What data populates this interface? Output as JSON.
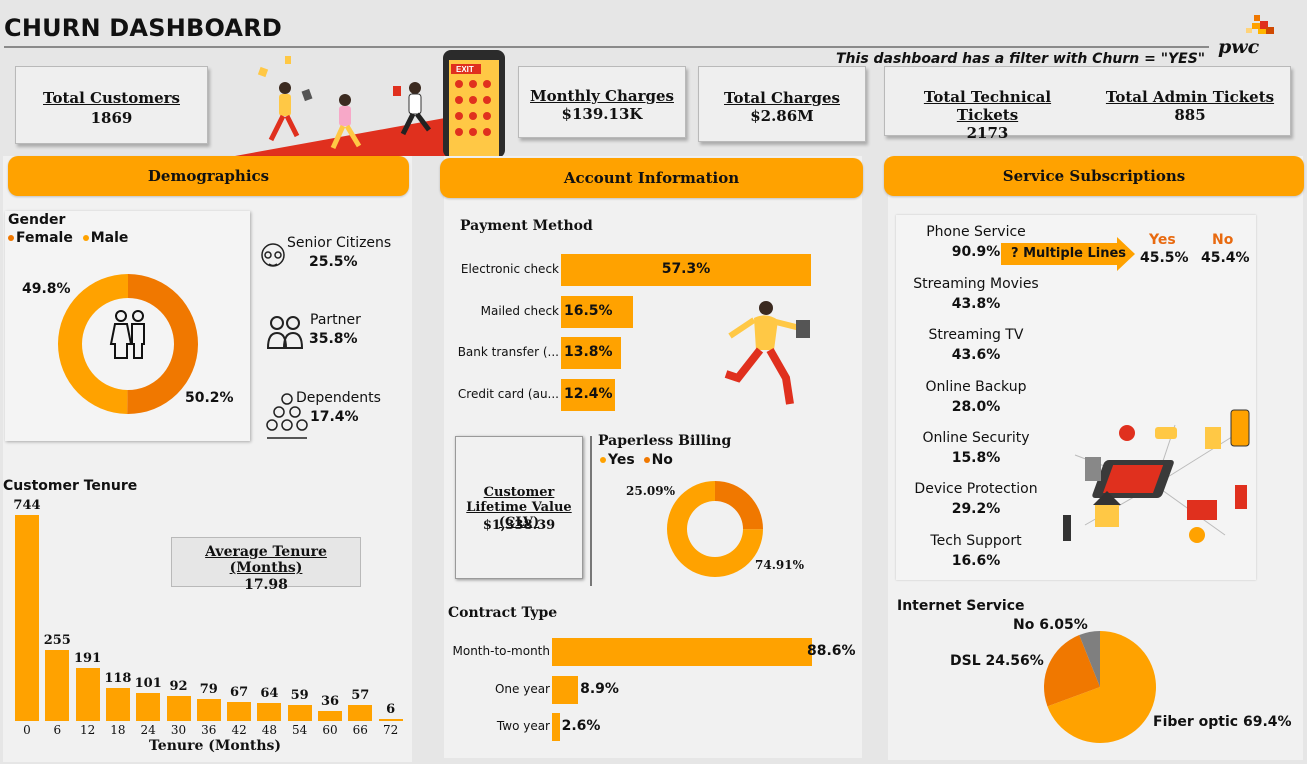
{
  "title": "CHURN DASHBOARD",
  "filter_note": "This dashboard has a filter with Churn = \"YES\"",
  "logo_text": "pwc",
  "kpis": {
    "total_customers": {
      "label": "Total Customers",
      "value": "1869"
    },
    "monthly_charges": {
      "label": "Monthly Charges",
      "value": "$139.13K"
    },
    "total_charges": {
      "label": "Total Charges",
      "value": "$2.86M"
    },
    "technical_tickets": {
      "label": "Total Technical Tickets",
      "value": "2173"
    },
    "admin_tickets": {
      "label": "Total Admin Tickets",
      "value": "885"
    }
  },
  "banner_sign": "EXIT",
  "sections": {
    "demographics": "Demographics",
    "account": "Account Information",
    "services": "Service Subscriptions"
  },
  "gender": {
    "title": "Gender",
    "legend": [
      "Female",
      "Male"
    ],
    "female_pct": "49.8%",
    "male_pct": "50.2%",
    "colors": {
      "female": "#f07800",
      "male": "#ffa200"
    }
  },
  "demo_stats": [
    {
      "label": "Senior Citizens",
      "value": "25.5%",
      "icon": "elderly-person-icon"
    },
    {
      "label": "Partner",
      "value": "35.8%",
      "icon": "couple-icon"
    },
    {
      "label": "Dependents",
      "value": "17.4%",
      "icon": "family-group-icon"
    }
  ],
  "tenure": {
    "title": "Customer Tenure",
    "xlabel": "Tenure (Months)",
    "avg_label": "Average Tenure (Months)",
    "avg_value": "17.98"
  },
  "payment": {
    "title": "Payment Method",
    "items": [
      {
        "label": "Electronic check",
        "value": "57.3%"
      },
      {
        "label": "Mailed check",
        "value": "16.5%"
      },
      {
        "label": "Bank transfer (...",
        "value": "13.8%"
      },
      {
        "label": "Credit card (au...",
        "value": "12.4%"
      }
    ]
  },
  "clv": {
    "label": "Customer Lifetime Value (CLV)",
    "value": "$1,338.39"
  },
  "paperless": {
    "title": "Paperless Billing",
    "legend": [
      "Yes",
      "No"
    ],
    "no_pct": "25.09%",
    "yes_pct": "74.91%",
    "colors": {
      "yes": "#ffa200",
      "no": "#f07800"
    }
  },
  "contract": {
    "title": "Contract Type",
    "items": [
      {
        "label": "Month-to-month",
        "value": "88.6%"
      },
      {
        "label": "One year",
        "value": "8.9%"
      },
      {
        "label": "Two year",
        "value": "2.6%"
      }
    ]
  },
  "services": {
    "phone": {
      "label": "Phone Service",
      "value": "90.9%"
    },
    "multiple_lines": {
      "label": "? Multiple Lines",
      "yes_label": "Yes",
      "no_label": "No",
      "yes": "45.5%",
      "no": "45.4%"
    },
    "list": [
      {
        "label": "Streaming Movies",
        "value": "43.8%"
      },
      {
        "label": "Streaming TV",
        "value": "43.6%"
      },
      {
        "label": "Online Backup",
        "value": "28.0%"
      },
      {
        "label": "Online Security",
        "value": "15.8%"
      },
      {
        "label": "Device Protection",
        "value": "29.2%"
      },
      {
        "label": "Tech Support",
        "value": "16.6%"
      }
    ]
  },
  "internet": {
    "title": "Internet Service",
    "no_label": "No 6.05%",
    "dsl_label": "DSL 24.56%",
    "fiber_label": "Fiber optic 69.4%",
    "colors": {
      "fiber": "#ffa200",
      "dsl": "#f07800",
      "no": "#7f7f7f"
    }
  },
  "chart_data": [
    {
      "type": "bar",
      "title": "Customer Tenure",
      "xlabel": "Tenure (Months)",
      "categories": [
        "0",
        "6",
        "12",
        "18",
        "24",
        "30",
        "36",
        "42",
        "48",
        "54",
        "60",
        "66",
        "72"
      ],
      "values": [
        744,
        255,
        191,
        118,
        101,
        92,
        79,
        67,
        64,
        59,
        36,
        57,
        6
      ],
      "ylim": [
        0,
        744
      ]
    },
    {
      "type": "bar",
      "title": "Payment Method",
      "orientation": "horizontal",
      "categories": [
        "Electronic check",
        "Mailed check",
        "Bank transfer (...",
        "Credit card (au..."
      ],
      "values": [
        57.3,
        16.5,
        13.8,
        12.4
      ]
    },
    {
      "type": "bar",
      "title": "Contract Type",
      "orientation": "horizontal",
      "categories": [
        "Month-to-month",
        "One year",
        "Two year"
      ],
      "values": [
        88.6,
        8.9,
        2.6
      ]
    },
    {
      "type": "pie",
      "title": "Gender",
      "categories": [
        "Female",
        "Male"
      ],
      "values": [
        49.8,
        50.2
      ]
    },
    {
      "type": "pie",
      "title": "Paperless Billing",
      "categories": [
        "Yes",
        "No"
      ],
      "values": [
        74.91,
        25.09
      ]
    },
    {
      "type": "pie",
      "title": "Internet Service",
      "categories": [
        "Fiber optic",
        "DSL",
        "No"
      ],
      "values": [
        69.4,
        24.56,
        6.05
      ]
    }
  ]
}
